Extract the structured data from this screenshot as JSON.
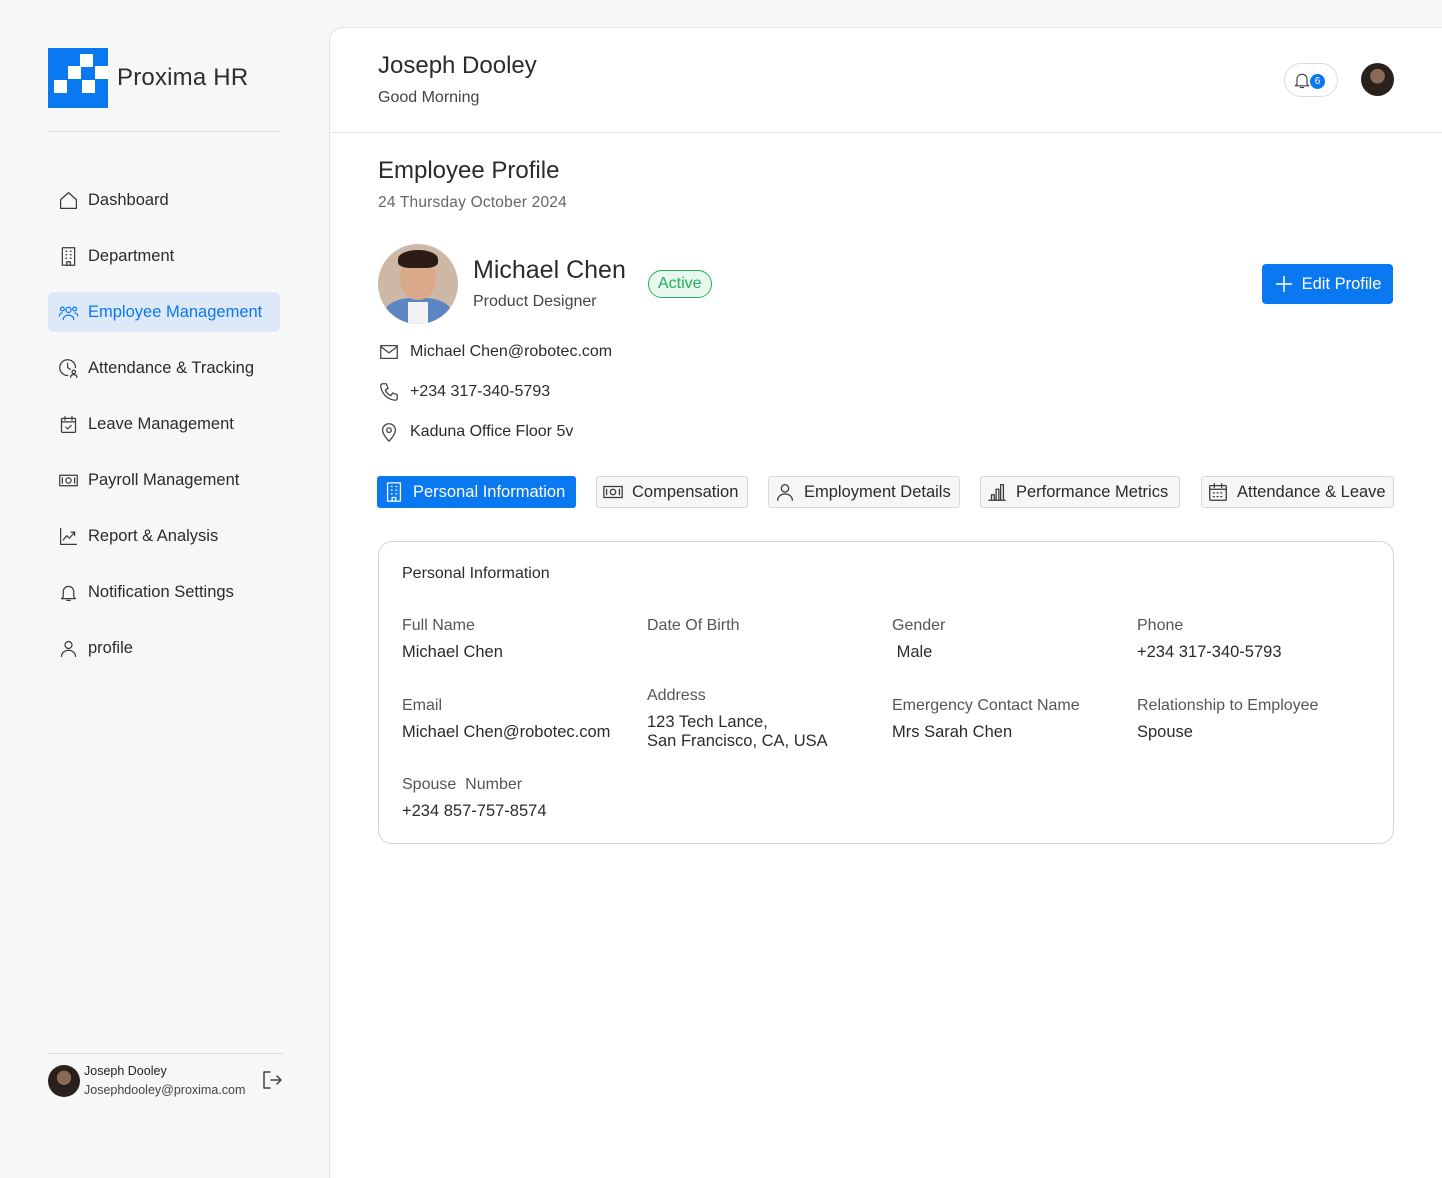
{
  "brand": {
    "name": "Proxima HR"
  },
  "sidebar": {
    "items": [
      {
        "label": "Dashboard",
        "icon": "home-icon",
        "active": false
      },
      {
        "label": "Department",
        "icon": "building-icon",
        "active": false
      },
      {
        "label": "Employee Management",
        "icon": "users-icon",
        "active": true
      },
      {
        "label": "Attendance & Tracking",
        "icon": "clock-user-icon",
        "active": false
      },
      {
        "label": "Leave Management",
        "icon": "calendar-check-icon",
        "active": false
      },
      {
        "label": "Payroll Management",
        "icon": "cash-icon",
        "active": false
      },
      {
        "label": "Report & Analysis",
        "icon": "chart-line-icon",
        "active": false
      },
      {
        "label": "Notification Settings",
        "icon": "bell-icon",
        "active": false
      },
      {
        "label": "profile",
        "icon": "user-icon",
        "active": false
      }
    ],
    "user": {
      "name": "Joseph Dooley",
      "email": "Josephdooley@proxima.com"
    }
  },
  "header": {
    "name": "Joseph Dooley",
    "greeting": "Good Morning",
    "notification_count": "6"
  },
  "page": {
    "title": "Employee Profile",
    "date": "24 Thursday October 2024"
  },
  "employee": {
    "name": "Michael Chen",
    "role": "Product Designer",
    "status": "Active",
    "edit_label": "Edit Profile",
    "email": "Michael Chen@robotec.com",
    "phone": "+234 317-340-5793",
    "location": "Kaduna Office Floor 5v"
  },
  "tabs": [
    {
      "label": "Personal Information",
      "icon": "building-icon",
      "active": true
    },
    {
      "label": "Compensation",
      "icon": "cash-icon",
      "active": false
    },
    {
      "label": "Employment Details",
      "icon": "user-icon",
      "active": false
    },
    {
      "label": "Performance Metrics",
      "icon": "bar-chart-icon",
      "active": false
    },
    {
      "label": "Attendance & Leave",
      "icon": "calendar-icon",
      "active": false
    }
  ],
  "personal": {
    "title": "Personal Information",
    "fields": [
      {
        "label": "Full Name",
        "value": "Michael Chen"
      },
      {
        "label": "Date Of Birth",
        "value": ""
      },
      {
        "label": "Gender",
        "value": " Male"
      },
      {
        "label": "Phone",
        "value": "+234 317-340-5793"
      },
      {
        "label": "Email",
        "value": "Michael Chen@robotec.com"
      },
      {
        "label": "Address",
        "value": "123 Tech Lance,\nSan Francisco, CA, USA"
      },
      {
        "label": "Emergency Contact Name",
        "value": "Mrs Sarah Chen"
      },
      {
        "label": "Relationship to Employee",
        "value": "Spouse"
      },
      {
        "label": "Spouse  Number",
        "value": "+234 857-757-8574"
      }
    ]
  },
  "colors": {
    "accent": "#0a78f0",
    "active_badge": "#1fae55",
    "active_nav_bg": "#dde9f9"
  }
}
